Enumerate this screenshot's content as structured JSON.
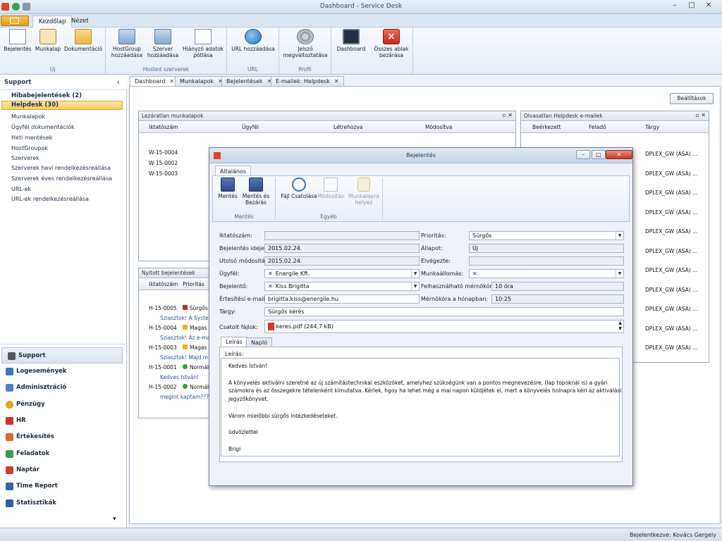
{
  "window": {
    "title": "Dashboard - Service Desk",
    "minimize": "–",
    "maximize": "□",
    "close": "✕"
  },
  "ribbon_tabs": [
    {
      "label": "Kezdőlap"
    },
    {
      "label": "Nézet"
    }
  ],
  "ribbon": {
    "groups": [
      {
        "label": "Új",
        "buttons": [
          "Bejelentés",
          "Munkalap",
          "Dokumentáció"
        ]
      },
      {
        "label": "Hosted szerverek",
        "buttons": [
          "HostGroup\nhozzáadása",
          "Szerver\nhozzáadása",
          "Hiányzó adatok\npótlása"
        ]
      },
      {
        "label": "URL",
        "buttons": [
          "URL hozzáadása"
        ]
      },
      {
        "label": "Profil",
        "buttons": [
          "Jelszó\nmegváltoztatása"
        ]
      },
      {
        "label": "",
        "buttons": [
          "Dashboard",
          "Összes ablak\nbezárása"
        ]
      }
    ]
  },
  "sidebar": {
    "title": "Support",
    "collapse": "‹",
    "items": [
      "Hibabejelentések (2)",
      "Helpdesk (30)",
      "Munkalapok",
      "Ügyfél dokumentációk",
      "Heti mentések",
      "HostGroupok",
      "Szerverek",
      "Szerverek havi rendelkezésreállása",
      "Szerverek éves rendelkezésreállása",
      "URL-ek",
      "URL-ek rendelkezésreállása"
    ],
    "nav": [
      "Support",
      "Logesemények",
      "Adminisztráció",
      "Pénzügy",
      "HR",
      "Értékesítés",
      "Feladatok",
      "Naptár",
      "Time Report",
      "Statisztikák"
    ],
    "more": "▾"
  },
  "doc_tabs": [
    {
      "label": "Dashboard"
    },
    {
      "label": "Munkalapok"
    },
    {
      "label": "Bejelentések"
    },
    {
      "label": "E-mailek: Helpdesk"
    }
  ],
  "settings_button": "Beállítások",
  "worksheets_pane": {
    "title": "Lezáratlan munkalapok",
    "columns": [
      "Iktatószám",
      "Ügyfél",
      "Létrehozva",
      "Módosítva"
    ],
    "rows": [
      "W-15-0004",
      "W-15-0002",
      "W-15-0003"
    ]
  },
  "emails_pane": {
    "title": "Olvasatlan Helpdesk e-mailek",
    "columns": [
      "Beérkezett",
      "Feladó",
      "Tárgy"
    ],
    "rows": [
      "DPLEX_GW (ASA) ...",
      "DPLEX_GW (ASA) ...",
      "DPLEX_GW (ASA) ...",
      "DPLEX_GW (ASA) ...",
      "DPLEX_GW (ASA) ...",
      "DPLEX_GW (ASA) ...",
      "DPLEX_GW (ASA) ...",
      "DPLEX_GW (ASA) ...",
      "DPLEX_GW (ASA) ...",
      "DPLEX_GW (ASA) ...",
      "DPLEX_GW (ASA) ..."
    ]
  },
  "tickets_pane": {
    "title": "Nyitott bejelentések",
    "columns": [
      "Iktatószám",
      "Prioritás"
    ],
    "rows": [
      {
        "id": "H-15-0005",
        "prio": "Sürgős",
        "preview": "Sziasztok!   A System"
      },
      {
        "id": "H-15-0004",
        "prio": "Magas",
        "preview": "Sziasztok!   Az e-mai"
      },
      {
        "id": "H-15-0003",
        "prio": "Magas",
        "preview": "Sziasztok!   Majd m"
      },
      {
        "id": "H-15-0001",
        "prio": "Normál",
        "preview": "Kedves István!"
      },
      {
        "id": "H-15-0002",
        "prio": "Normál",
        "preview": "megint kaptam???? c"
      }
    ]
  },
  "dialog": {
    "title": "Bejelentés",
    "tab": "Általános",
    "buttons": {
      "save": "Mentés",
      "save_close": "Mentés és\nBezárás",
      "attach": "Fájl Csatolása",
      "modify": "Módosítás",
      "to_worksheet": "Munkalapra\nhelyez"
    },
    "groups": {
      "save": "Mentés",
      "other": "Egyéb"
    },
    "labels": {
      "id": "Iktatószám:",
      "reported": "Bejelentés ideje:",
      "modified": "Utolsó módosítás:",
      "customer": "Ügyfél:",
      "reporter": "Bejelentő:",
      "email": "Értesítési e-mail:",
      "subject": "Tárgy:",
      "attachments": "Csatolt fájlok:",
      "priority": "Prioritás:",
      "state": "Állapot:",
      "done": "Elvégezte:",
      "workstation": "Munkaállomás:",
      "hours": "Felhasználható mérnökóra:",
      "monthly": "Mérnökóra a hónapban:"
    },
    "values": {
      "id": "",
      "reported": "2015.02.24.",
      "modified": "2015.02.24.",
      "customer": "Energile Kft.",
      "reporter": "Kiss Brigitta",
      "email": "brigitta.kiss@energile.hu",
      "subject": "Sürgős kérés",
      "attachment": "keres.pdf (244,7 kB)",
      "priority": "Sürgős",
      "state": "Új",
      "done": "",
      "workstation": "",
      "hours": "10 óra",
      "monthly": "10:25"
    },
    "subtabs": [
      "Leírás",
      "Napló"
    ],
    "desc_label": "Leírás:",
    "desc_lines": [
      "Kedves István!",
      "",
      "A könyvelés aktiválni szeretné az új  számítástechnikai eszközöket, amelyhez szükségünk van a pontos megnevezésre, (lap topoknál is)  a gyári",
      "számokra és az összegekre tételenként kimutatva. Kérlek, hgoy  ha lehet még a mai napon küldjétek el, mert a könyvelés holnapra kéri az aktiválási",
      "jegyzőkönyvet.",
      "",
      "Várom mielőbbi sürgős intézkedéseteket.",
      "",
      "üdvözlettel",
      "",
      "Brigi"
    ]
  },
  "status": {
    "text": "Bejelentkezve: Kovács Gergely"
  },
  "colors": {
    "accent": "#f8cc5e",
    "urgent": "#d3261c",
    "high": "#f0b020",
    "normal": "#2ea32e"
  }
}
